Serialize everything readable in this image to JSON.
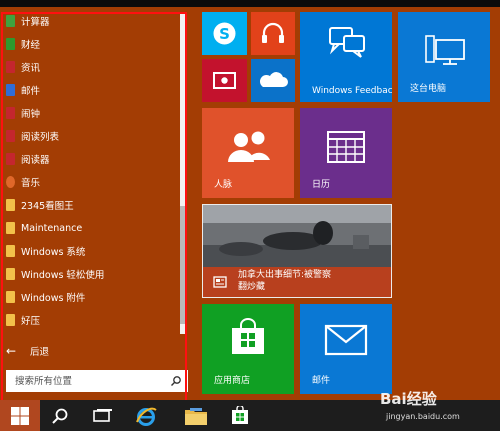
{
  "app_list": {
    "items": [
      {
        "label": "计算器",
        "icon": "calculator-icon",
        "color": "#3fa33f"
      },
      {
        "label": "财经",
        "icon": "finance-icon",
        "color": "#2e9a2e"
      },
      {
        "label": "资讯",
        "icon": "news-icon",
        "color": "#c4262e"
      },
      {
        "label": "邮件",
        "icon": "mail-icon",
        "color": "#2f6dd6"
      },
      {
        "label": "闹钟",
        "icon": "alarm-icon",
        "color": "#c4262e"
      },
      {
        "label": "阅读列表",
        "icon": "reading-list-icon",
        "color": "#c4262e"
      },
      {
        "label": "阅读器",
        "icon": "reader-icon",
        "color": "#c4262e"
      },
      {
        "label": "音乐",
        "icon": "music-icon",
        "color": "#e0672a"
      },
      {
        "label": "2345看图王",
        "icon": "folder-icon",
        "color": "#f2c14a"
      },
      {
        "label": "Maintenance",
        "icon": "folder-icon",
        "color": "#f2c14a"
      },
      {
        "label": "Windows 系统",
        "icon": "folder-icon",
        "color": "#f2c14a"
      },
      {
        "label": "Windows 轻松使用",
        "icon": "folder-icon",
        "color": "#f2c14a"
      },
      {
        "label": "Windows 附件",
        "icon": "folder-icon",
        "color": "#f2c14a"
      },
      {
        "label": "好压",
        "icon": "folder-icon",
        "color": "#f2c14a"
      }
    ],
    "back_label": "后退"
  },
  "search": {
    "placeholder": "搜索所有位置"
  },
  "tiles": {
    "windows_feedback": "Windows Feedback",
    "this_pc": "这台电脑",
    "people": "人脉",
    "calendar": "日历",
    "news_headline_line1": "加拿大出事细节:被警察",
    "news_headline_line2": "翻炒藏",
    "store": "应用商店",
    "mail": "邮件"
  },
  "taskbar": {
    "items": [
      "start-button",
      "search-button",
      "task-view-button",
      "internet-explorer-button",
      "file-explorer-button",
      "store-button"
    ]
  },
  "watermark": {
    "brand": "Bai经验",
    "url": "jingyan.baidu.com"
  },
  "colors": {
    "accent": "#a33d04",
    "skype": "#00aff0",
    "music_tile": "#e2421a",
    "video_tile": "#c3122d",
    "onedrive": "#0b72c9",
    "feedback": "#0077d5",
    "people": "#e0522b",
    "calendar": "#6b2e8c",
    "store": "#10a023",
    "mail": "#0a78d4",
    "highlight": "#ff1010"
  }
}
